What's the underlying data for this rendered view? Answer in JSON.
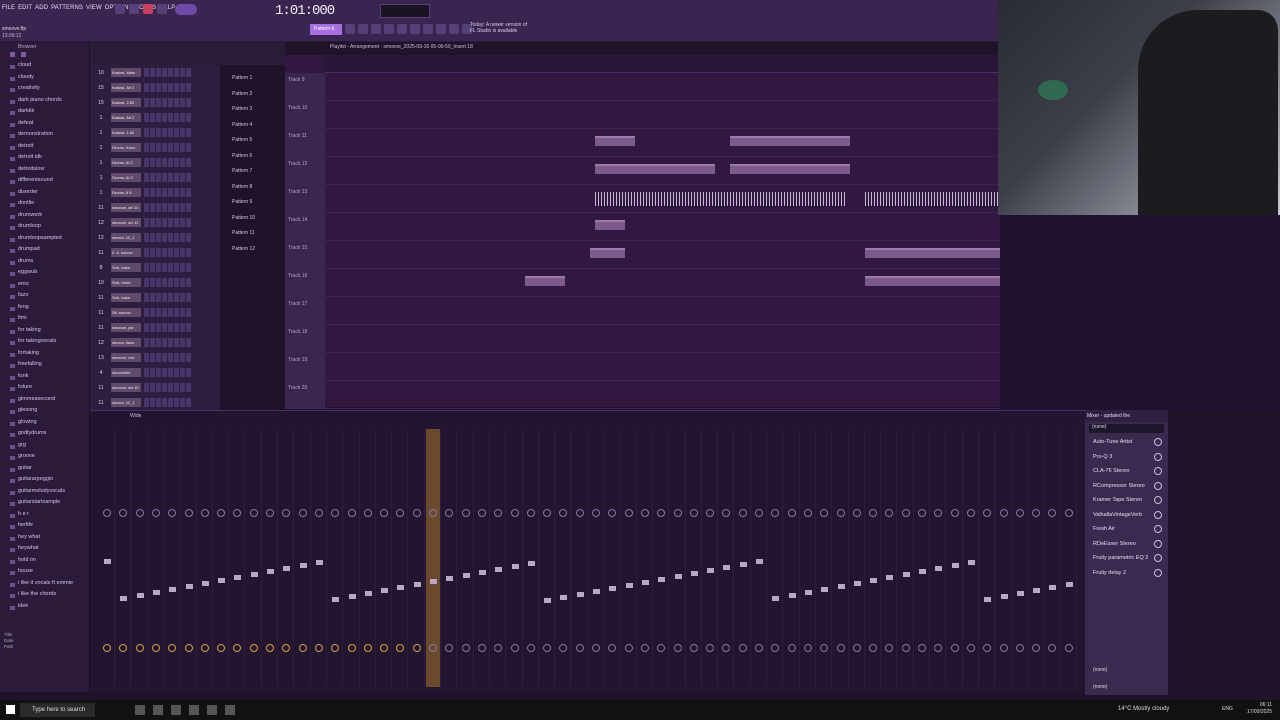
{
  "menu": [
    "FILE",
    "EDIT",
    "ADD",
    "PATTERNS",
    "VIEW",
    "OPTIONS",
    "TOOLS",
    "HELP"
  ],
  "toolbar": {
    "time": "1:01:000",
    "pattern": "Pattern 6",
    "news": "Today: A newer version of FL Studio is available"
  },
  "project": {
    "file": "smoove.flp",
    "hint": "13:09:12",
    "arrangement_title": "Playlist - Arrangement · smoove_2025-09-16 05-00-50_Insert 18"
  },
  "browser": {
    "title": "Browser",
    "items": [
      "cloud",
      "cloudy",
      "creativity",
      "dark piano chords",
      "darkkk",
      "defeat",
      "demonstration",
      "detroit",
      "detroit idk",
      "detroitslow",
      "differentsound",
      "disorder",
      "dontlie",
      "drumwork",
      "drumloop",
      "drumloopsampled",
      "drumpad",
      "drums",
      "eggwub",
      "emo",
      "fazo",
      "feng",
      "fimi",
      "for taking",
      "for takingvocals",
      "fortaking",
      "freefalling",
      "funk",
      "future",
      "gimmeasecond",
      "glesong",
      "glowing",
      "godlydrums",
      "grg",
      "groove",
      "guitar",
      "guitararpeggio",
      "guitarmelodyvocals",
      "guitarstartsample",
      "h e r",
      "herlife",
      "hey what",
      "heywhat",
      "hold on",
      "house",
      "i like it vocals ft emmie",
      "i like the chords",
      "idek"
    ],
    "info": {
      "title": "Title",
      "date": "Date",
      "path": "Path"
    }
  },
  "channels": [
    {
      "num": "10",
      "name": "Kadosi, Main"
    },
    {
      "num": "15",
      "name": "Kadosi, Alt 2"
    },
    {
      "num": "15",
      "name": "Kadosi, 2.82"
    },
    {
      "num": "1",
      "name": "Kadosi, Alt 2"
    },
    {
      "num": "1",
      "name": "Kadosi, 1.82"
    },
    {
      "num": "1",
      "name": "Drums, Kono"
    },
    {
      "num": "1",
      "name": "Drums, Al 2"
    },
    {
      "num": "1",
      "name": "Drums, Al 3"
    },
    {
      "num": "1",
      "name": "Drums, 6 8"
    },
    {
      "num": "11",
      "name": "smoove, art 10"
    },
    {
      "num": "12",
      "name": "smoove, art 12"
    },
    {
      "num": "12",
      "name": "smoov, 12_1"
    },
    {
      "num": "11",
      "name": "2. 6. smoov"
    },
    {
      "num": "8",
      "name": "Sub, bass"
    },
    {
      "num": "10",
      "name": "Sub, more"
    },
    {
      "num": "11",
      "name": "Sub, bass"
    },
    {
      "num": "11",
      "name": "Sit, smoov"
    },
    {
      "num": "11",
      "name": "smoove, ple"
    },
    {
      "num": "12",
      "name": "smoov, bass"
    },
    {
      "num": "13",
      "name": "smoove, mix"
    },
    {
      "num": "4",
      "name": "smoovetrk"
    },
    {
      "num": "11",
      "name": "smoove, art 10"
    },
    {
      "num": "11",
      "name": "smoov, 12_1"
    }
  ],
  "patterns": [
    "Pattern 1",
    "Pattern 2",
    "Pattern 3",
    "Pattern 4",
    "Pattern 5",
    "Pattern 6",
    "Pattern 7",
    "Pattern 8",
    "Pattern 9",
    "Pattern 10",
    "Pattern 11",
    "Pattern 12"
  ],
  "tracks": [
    "Track 9",
    "Track 10",
    "Track 11",
    "Track 12",
    "Track 13",
    "Track 14",
    "Track 15",
    "Track 16",
    "Track 17",
    "Track 18",
    "Track 19",
    "Track 20"
  ],
  "mixer": {
    "title": "Mixer - updated the",
    "wide": "Wide",
    "current": "(none)",
    "slots": [
      "Auto-Tune Artist",
      "Pro-Q 3",
      "CLA-76 Stereo",
      "RCompressor Stereo",
      "Kramer Tape Stereo",
      "ValhallaVintageVerb",
      "Fresh Air",
      "RDeEsser Stereo",
      "Fruity parametric EQ 2",
      "Fruity delay 2"
    ],
    "out": "(none)",
    "out2": "(none)"
  },
  "taskbar": {
    "search": "Type here to search",
    "weather": "14°C Mostly cloudy",
    "lang": "ENG",
    "time": "06:11",
    "date": "17/09/2025"
  },
  "colors": {
    "accent": "#b06fe0",
    "mixer_selected": "#d7a04a"
  }
}
